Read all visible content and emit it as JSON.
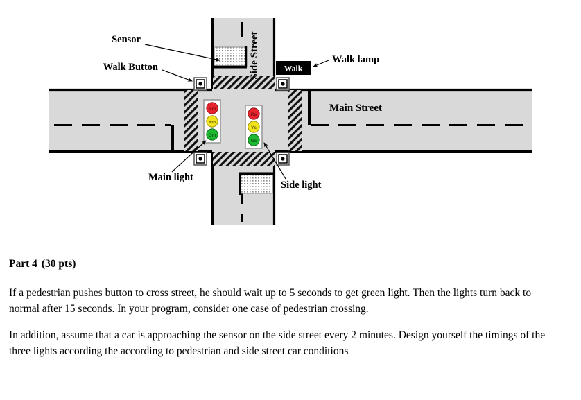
{
  "diagram": {
    "title": "Traffic intersection diagram",
    "street_labels": {
      "side_street": "Side Street",
      "main_street": "Main Street"
    },
    "callouts": {
      "sensor": "Sensor",
      "walk_button": "Walk Button",
      "walk_lamp": "Walk lamp",
      "main_light": "Main light",
      "side_light": "Side light"
    },
    "walk_lamp_box": {
      "text": "Walk",
      "background": "#000000",
      "text_color": "#ffffff"
    },
    "main_traffic_light": {
      "name": "Main light",
      "lamps": [
        {
          "label": "Rm",
          "color": "#E8252C",
          "meaning": "red-main"
        },
        {
          "label": "Ym",
          "color": "#F2E41C",
          "meaning": "yellow-main"
        },
        {
          "label": "Gm",
          "color": "#1DB930",
          "meaning": "green-main"
        }
      ]
    },
    "side_traffic_light": {
      "name": "Side light",
      "lamps": [
        {
          "label": "Rs",
          "color": "#E8252C",
          "meaning": "red-side"
        },
        {
          "label": "Ys",
          "color": "#F2E41C",
          "meaning": "yellow-side"
        },
        {
          "label": "Gs",
          "color": "#1DB930",
          "meaning": "green-side"
        }
      ]
    },
    "colors": {
      "road_fill": "#D9D9D9",
      "road_edge": "#000000",
      "page_background": "#FFFFFF",
      "sensor_fill": "#FFFFFF"
    },
    "walk_buttons_count": 4,
    "sensors_count": 2
  },
  "text": {
    "heading_label": "Part 4",
    "heading_points": "(30 pts)",
    "paragraph1_part1": "If a pedestrian pushes button to cross street, he should wait up to 5 seconds to get green light.",
    "paragraph1_underlined": "Then the lights turn back to normal after 15 seconds. In your program, consider one case of pedestrian crossing.",
    "paragraph2": "In addition, assume that a car is approaching the sensor on the side street every 2 minutes. Design yourself the timings of the three lights according the according to pedestrian and side street car conditions"
  }
}
